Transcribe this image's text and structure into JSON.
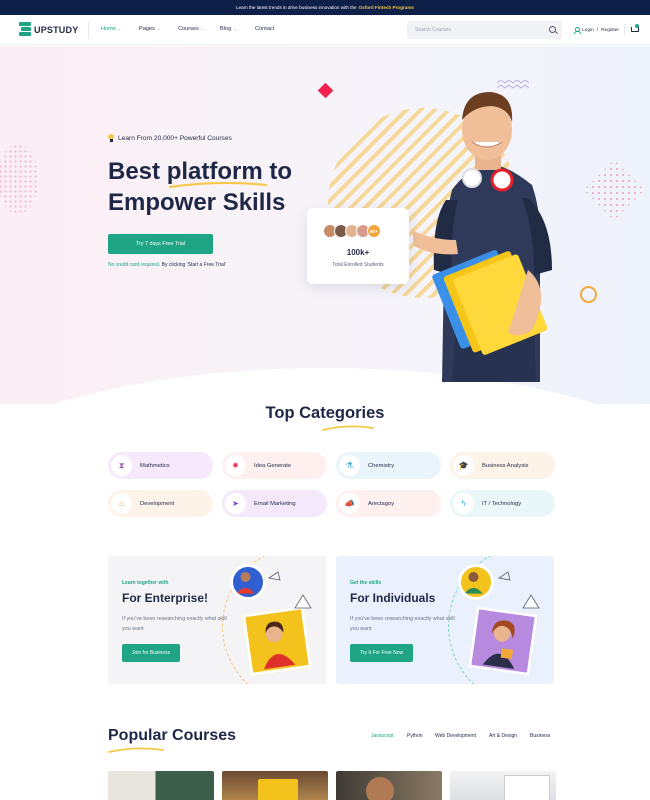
{
  "topbar": {
    "text": "Learn the latest trends in drive business innovation with the",
    "highlight": "Oxford Fintech Programs"
  },
  "header": {
    "brand": "UPSTUDY",
    "nav": [
      {
        "label": "Home",
        "active": true
      },
      {
        "label": "Pages",
        "active": false
      },
      {
        "label": "Courses",
        "active": false
      },
      {
        "label": "Blog",
        "active": false
      },
      {
        "label": "Contact",
        "active": false
      }
    ],
    "search_placeholder": "Search Courses",
    "login": "Login",
    "divider": "/",
    "register": "Register"
  },
  "hero": {
    "tagline": "Learn From 20,000+ Powerful Courses",
    "headline_1": "Best platform to",
    "headline_2": "Empower Skills",
    "cta": "Try 7 days Free Trial",
    "note_prefix": "No credit card required.",
    "note_suffix": " By clicking 'Start a Free Trial'",
    "enrolled_count": "100k+",
    "enrolled_label": "Total Enrolled Students",
    "avatar_more": "5K+"
  },
  "categories": {
    "title": "Top Categories",
    "items": [
      {
        "label": "Mathmetics",
        "icon": "hourglass-icon",
        "bg": "#f5e9fb"
      },
      {
        "label": "Idea Generate",
        "icon": "lightbulb-icon",
        "bg": "#fdf0ee"
      },
      {
        "label": "Chemistry",
        "icon": "flask-icon",
        "bg": "#eaf5fb"
      },
      {
        "label": "Business Analysis",
        "icon": "graduation-cap-icon",
        "bg": "#fdf3e8"
      },
      {
        "label": "Development",
        "icon": "house-icon",
        "bg": "#fdf3e8"
      },
      {
        "label": "Email Marketing",
        "icon": "paper-plane-icon",
        "bg": "#f3e9fb"
      },
      {
        "label": "Arectagoy",
        "icon": "megaphone-icon",
        "bg": "#fdf0ee"
      },
      {
        "label": "IT / Technology",
        "icon": "lightning-icon",
        "bg": "#eaf7f8"
      }
    ]
  },
  "promos": [
    {
      "kicker": "Learn together with",
      "title": "For Enterprise!",
      "desc": "If you've been researching exactly what skill you want",
      "button": "Join for Business",
      "bg": "#f4f4f6"
    },
    {
      "kicker": "Get the skills",
      "title": "For Individuals",
      "desc": "If you've been researching exactly what skill you want",
      "button": "Try It For Free Now",
      "bg": "#eaf0fc"
    }
  ],
  "popular": {
    "title": "Popular Courses",
    "filters": [
      {
        "label": "Javascript",
        "active": true
      },
      {
        "label": "Python",
        "active": false
      },
      {
        "label": "Web Development",
        "active": false
      },
      {
        "label": "Art & Design",
        "active": false
      },
      {
        "label": "Business",
        "active": false
      }
    ]
  },
  "colors": {
    "accent": "#1fa584",
    "navy": "#1f2746",
    "topbar": "#0e2048",
    "highlight": "#f5c84a"
  }
}
